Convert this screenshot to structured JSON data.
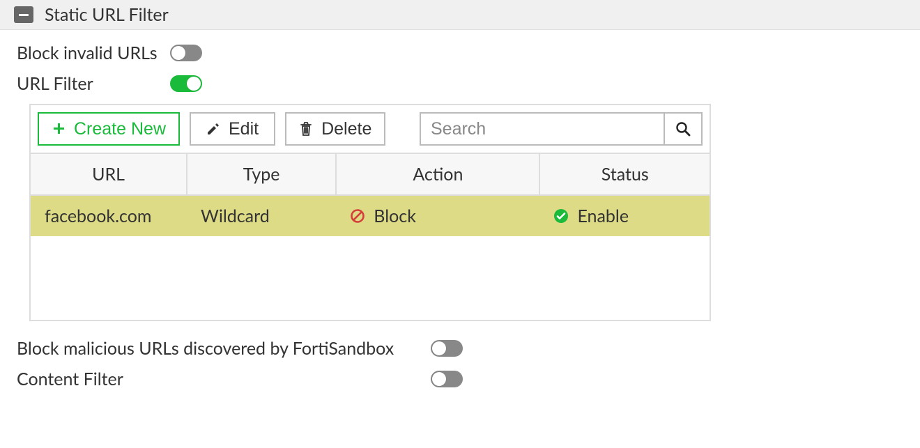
{
  "section_title": "Static URL Filter",
  "toggles": {
    "block_invalid_urls": {
      "label": "Block invalid URLs",
      "on": false
    },
    "url_filter": {
      "label": "URL Filter",
      "on": true
    },
    "block_malicious": {
      "label": "Block malicious URLs discovered by FortiSandbox",
      "on": false
    },
    "content_filter": {
      "label": "Content Filter",
      "on": false
    }
  },
  "toolbar": {
    "create_label": "Create New",
    "edit_label": "Edit",
    "delete_label": "Delete",
    "search_placeholder": "Search"
  },
  "table": {
    "headers": {
      "url": "URL",
      "type": "Type",
      "action": "Action",
      "status": "Status"
    },
    "rows": [
      {
        "url": "facebook.com",
        "type": "Wildcard",
        "action": "Block",
        "status": "Enable",
        "selected": true
      }
    ]
  },
  "colors": {
    "accent_green": "#1aba3b",
    "block_red": "#d43f3a"
  }
}
